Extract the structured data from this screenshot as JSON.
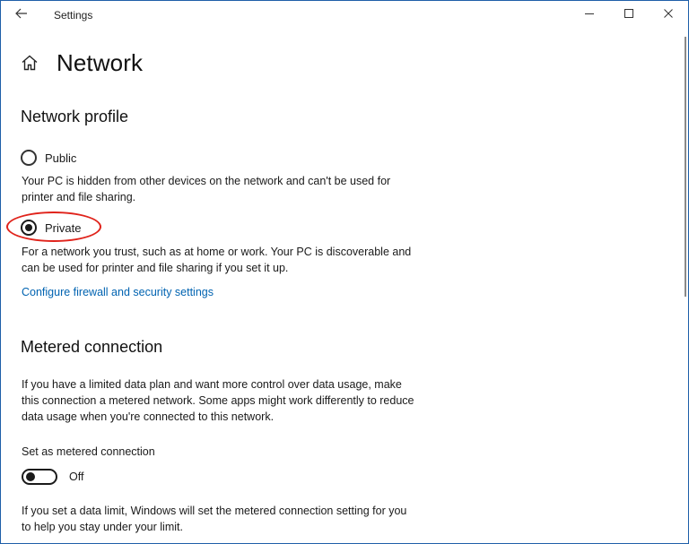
{
  "window": {
    "title": "Settings",
    "controls": {
      "back": "back-arrow-icon",
      "minimize": "minimize-icon",
      "maximize": "maximize-icon",
      "close": "close-icon"
    }
  },
  "header": {
    "icon": "home-icon",
    "title": "Network"
  },
  "network_profile": {
    "heading": "Network profile",
    "options": [
      {
        "label": "Public",
        "selected": false,
        "description": "Your PC is hidden from other devices on the network and can't be used for printer and file sharing."
      },
      {
        "label": "Private",
        "selected": true,
        "description": "For a network you trust, such as at home or work. Your PC is discoverable and can be used for printer and file sharing if you set it up."
      }
    ],
    "link": "Configure firewall and security settings"
  },
  "metered_connection": {
    "heading": "Metered connection",
    "description": "If you have a limited data plan and want more control over data usage, make this connection a metered network. Some apps might work differently to reduce data usage when you're connected to this network.",
    "toggle_label": "Set as metered connection",
    "toggle_state": "Off",
    "toggle_on": false,
    "limit_note": "If you set a data limit, Windows will set the metered connection setting for you to help you stay under your limit."
  },
  "colors": {
    "link": "#0063b1",
    "highlight": "#e0231b",
    "window_border": "#1f5fa8"
  }
}
